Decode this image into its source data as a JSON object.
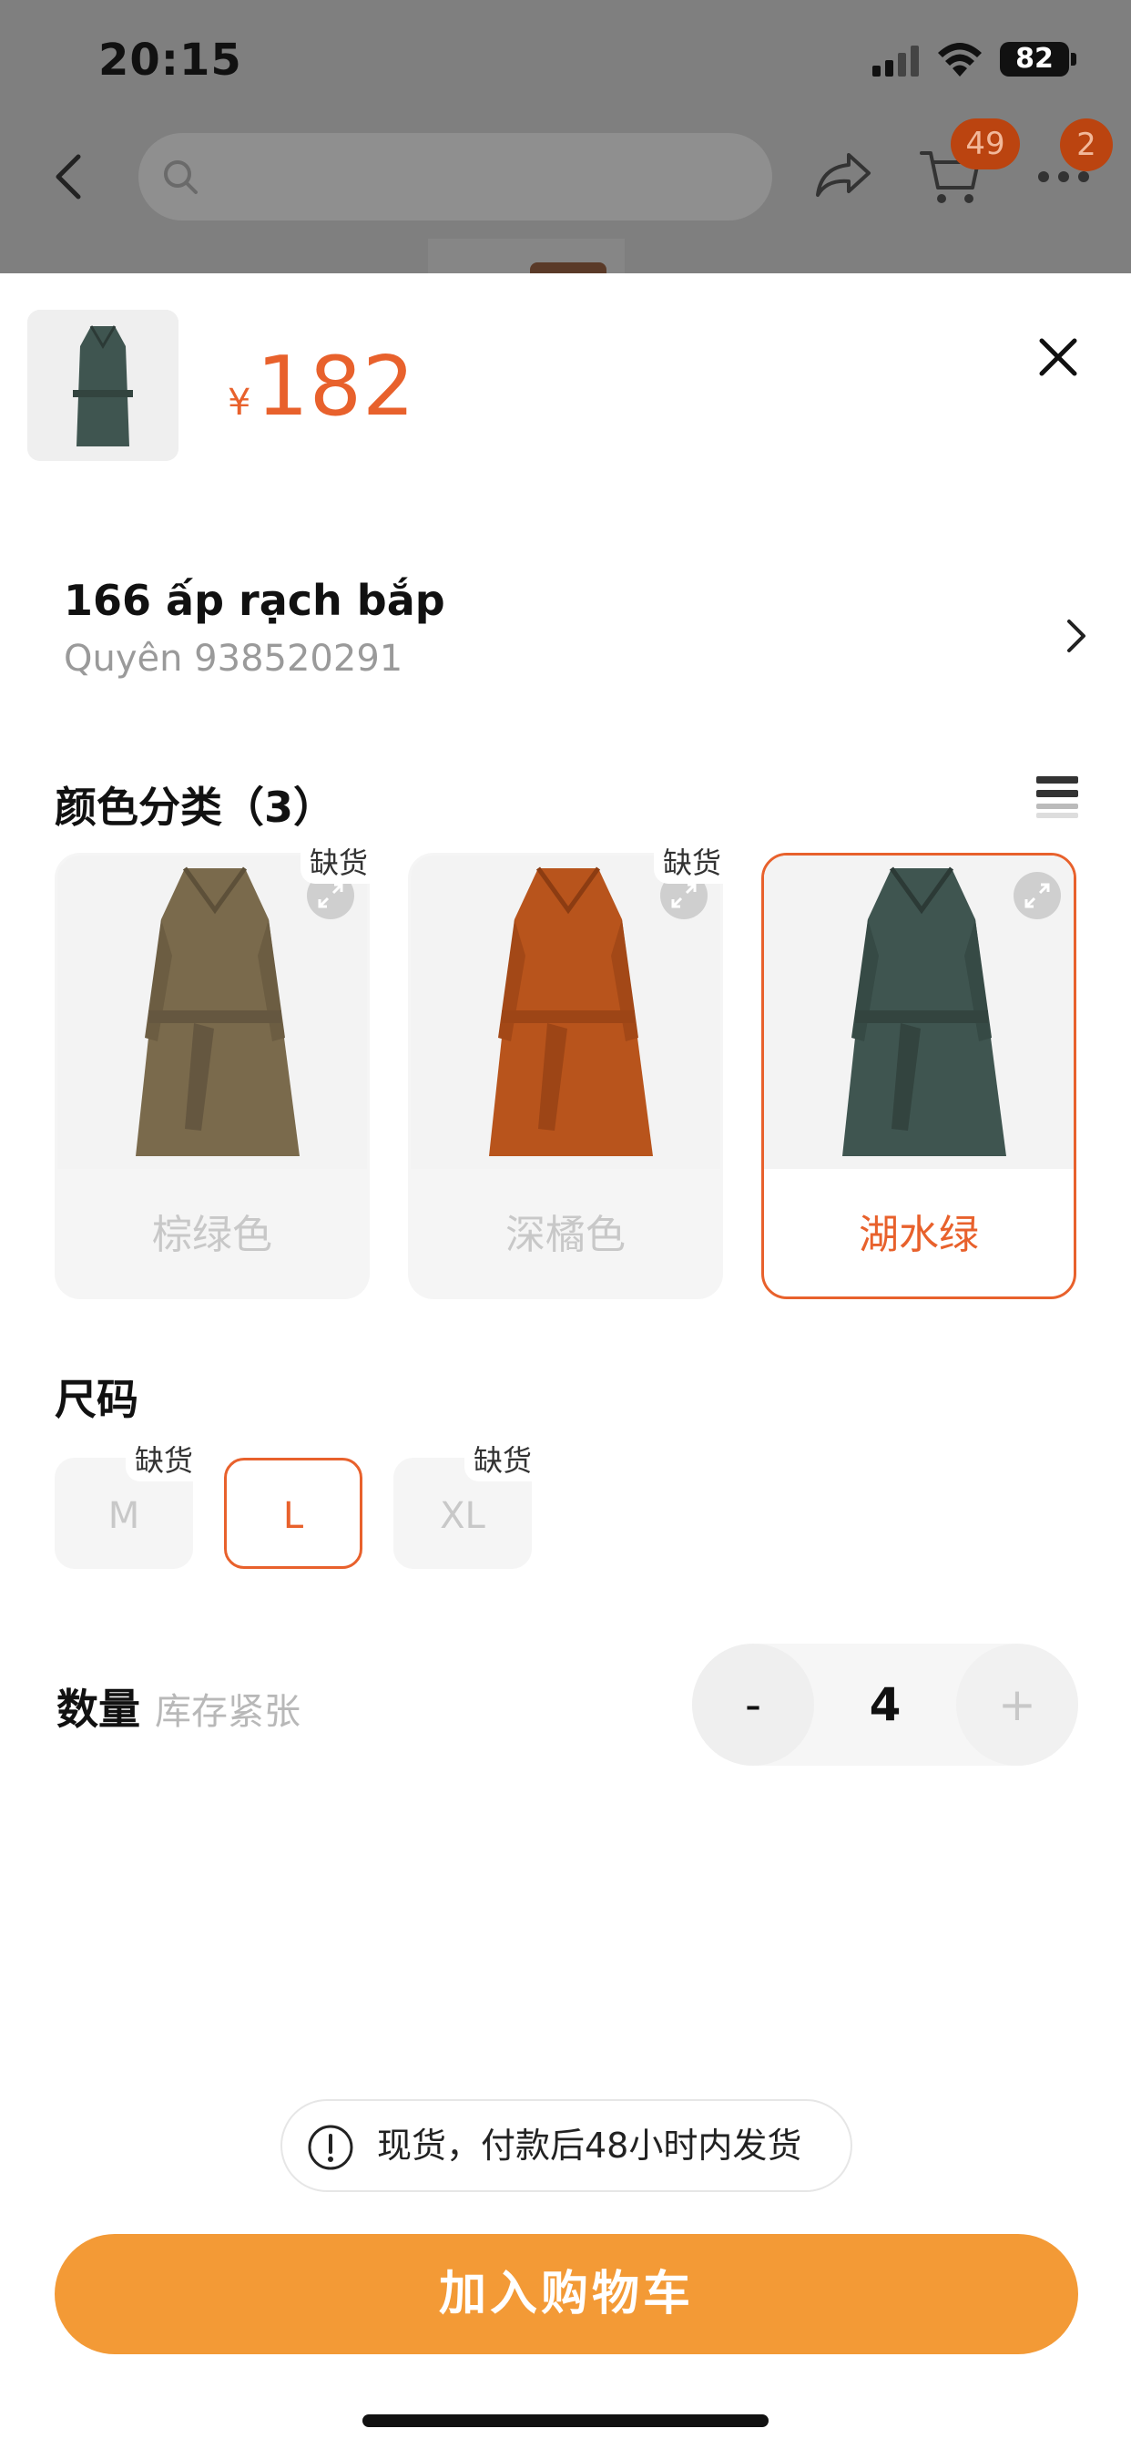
{
  "status_bar": {
    "time": "20:15",
    "battery": "82"
  },
  "top_nav": {
    "cart_count": "49",
    "more_badge": "2"
  },
  "product": {
    "price_symbol": "¥",
    "price": "182"
  },
  "address": {
    "line": "166 ấp rạch bắp",
    "recipient": "Quyên 938520291"
  },
  "colors": {
    "title": "颜色分类（3）",
    "options": [
      {
        "name": "棕绿色",
        "tag": "缺货",
        "selected": false,
        "swatch": "#7a6a4c"
      },
      {
        "name": "深橘色",
        "tag": "缺货",
        "selected": false,
        "swatch": "#b8541c"
      },
      {
        "name": "湖水绿",
        "tag": "",
        "selected": true,
        "swatch": "#3f5550"
      }
    ]
  },
  "sizes": {
    "title": "尺码",
    "options": [
      {
        "label": "M",
        "tag": "缺货",
        "selected": false
      },
      {
        "label": "L",
        "tag": "",
        "selected": true
      },
      {
        "label": "XL",
        "tag": "缺货",
        "selected": false
      }
    ]
  },
  "quantity": {
    "label": "数量",
    "hint": "库存紧张",
    "minus": "-",
    "value": "4",
    "plus": "+"
  },
  "notice": "现货，付款后48小时内发货",
  "add_to_cart": "加入购物车",
  "colors_theme": {
    "accent": "#e8612c",
    "button": "#f39a36",
    "badge": "#bb4410"
  }
}
